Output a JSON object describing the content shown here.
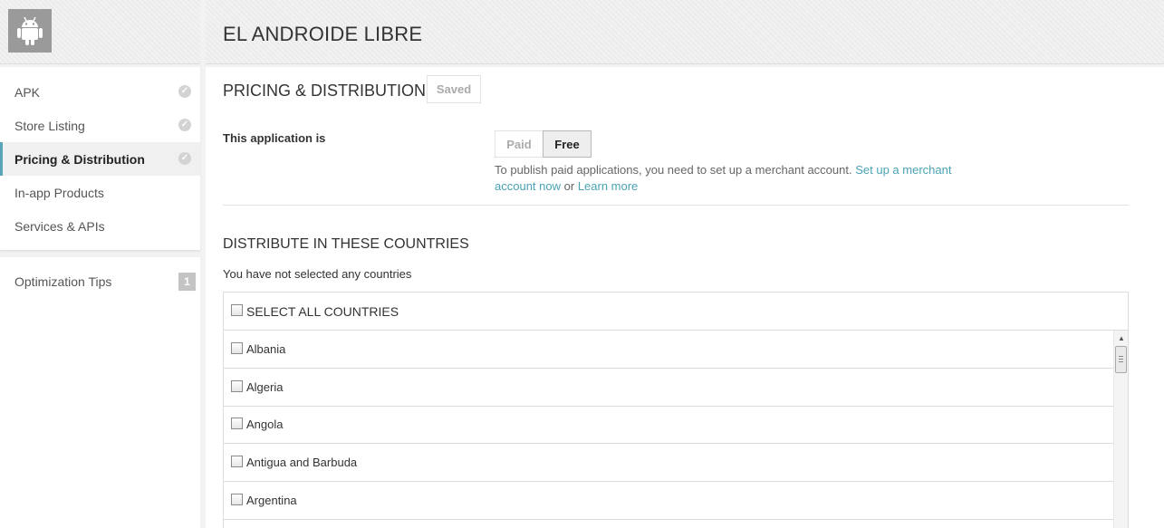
{
  "header": {
    "app_title": "EL ANDROIDE LIBRE",
    "app_icon": "android-icon"
  },
  "sidebar": {
    "items": [
      {
        "label": "APK",
        "status": "complete"
      },
      {
        "label": "Store Listing",
        "status": "complete"
      },
      {
        "label": "Pricing & Distribution",
        "status": "complete",
        "active": true
      },
      {
        "label": "In-app Products"
      },
      {
        "label": "Services & APIs"
      }
    ],
    "optimization": {
      "label": "Optimization Tips",
      "count": "1"
    }
  },
  "main": {
    "section_title": "PRICING & DISTRIBUTION",
    "saved_label": "Saved",
    "app_is_label": "This application is",
    "paid_label": "Paid",
    "free_label": "Free",
    "selected_price_option": "Free",
    "merchant_note_text": "To publish paid applications, you need to set up a merchant account.",
    "merchant_link_text": "Set up a merchant account now",
    "or_text": "or",
    "learn_more_text": "Learn more",
    "countries_title": "DISTRIBUTE IN THESE COUNTRIES",
    "countries_status": "You have not selected any countries",
    "select_all_label": "SELECT ALL COUNTRIES",
    "countries": [
      "Albania",
      "Algeria",
      "Angola",
      "Antigua and Barbuda",
      "Argentina"
    ]
  },
  "colors": {
    "accent_link": "#4aa3b5",
    "active_nav_border": "#59a5b8"
  }
}
